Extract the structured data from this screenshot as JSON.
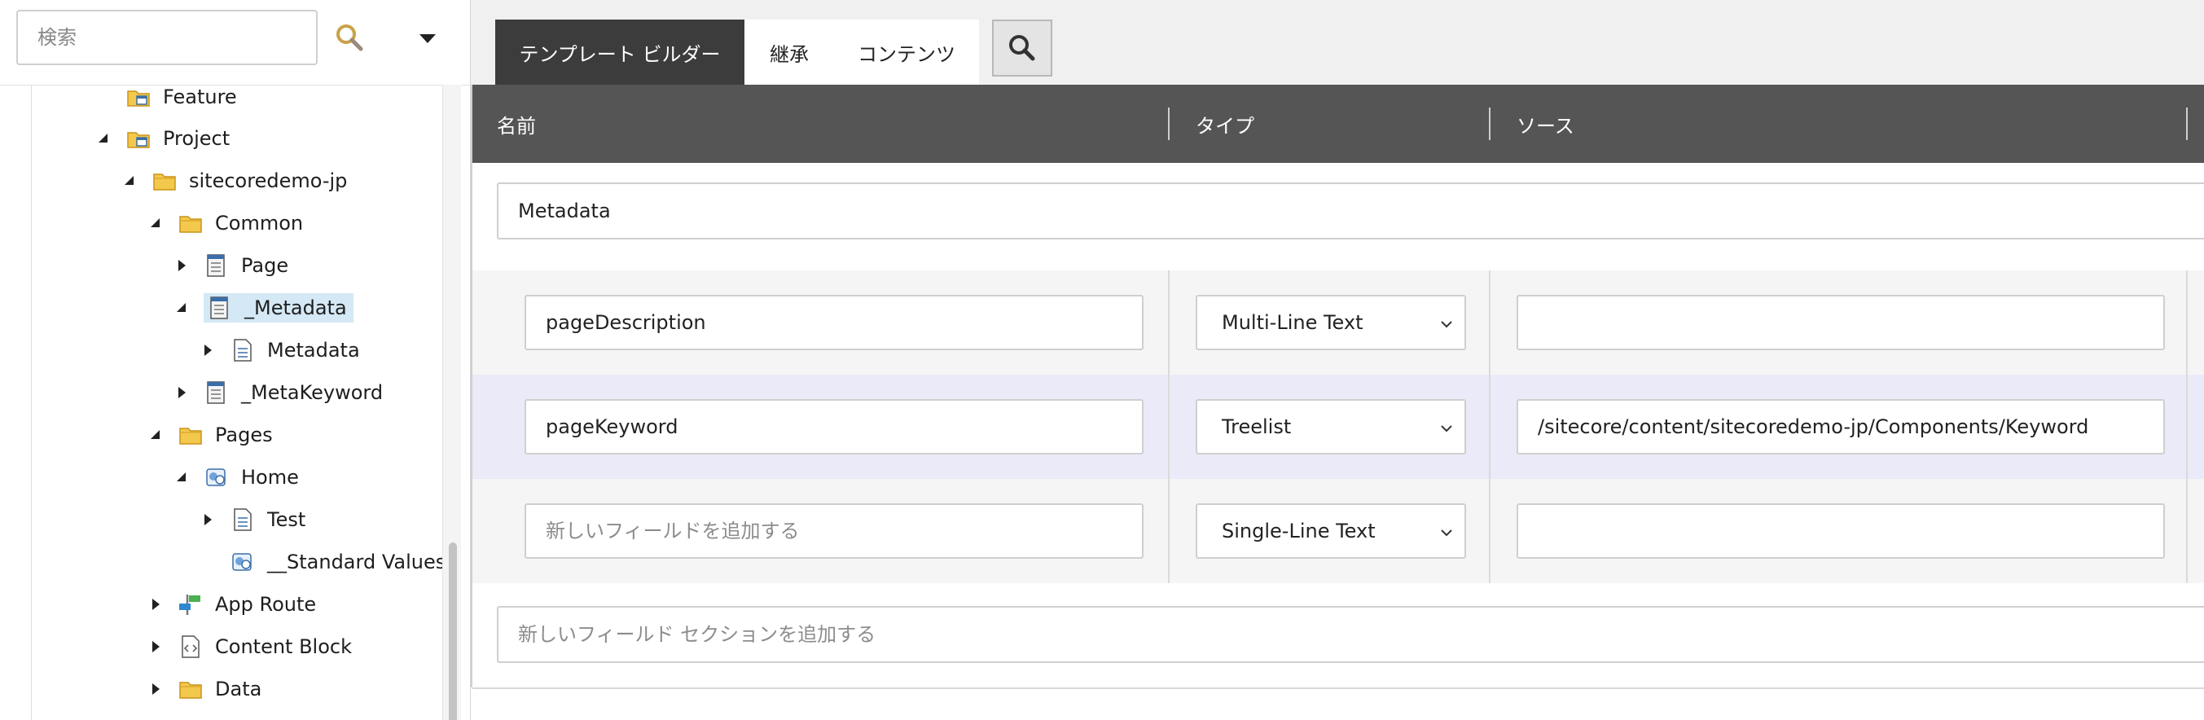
{
  "left": {
    "search_placeholder": "検索",
    "tree": [
      {
        "label": "Feature",
        "icon": "template-folder-icon"
      },
      {
        "label": "Project",
        "icon": "template-folder-icon"
      },
      {
        "label": "sitecoredemo-jp",
        "icon": "folder-icon"
      },
      {
        "label": "Common",
        "icon": "folder-icon"
      },
      {
        "label": "Page",
        "icon": "template-icon"
      },
      {
        "label": "_Metadata",
        "icon": "template-icon"
      },
      {
        "label": "Metadata",
        "icon": "section-icon"
      },
      {
        "label": "_MetaKeyword",
        "icon": "template-icon"
      },
      {
        "label": "Pages",
        "icon": "folder-icon"
      },
      {
        "label": "Home",
        "icon": "page-template-icon"
      },
      {
        "label": "Test",
        "icon": "section-icon"
      },
      {
        "label": "__Standard Values",
        "icon": "page-template-icon"
      },
      {
        "label": "App Route",
        "icon": "route-icon"
      },
      {
        "label": "Content Block",
        "icon": "content-block-icon"
      },
      {
        "label": "Data",
        "icon": "folder-icon"
      }
    ]
  },
  "tabs": {
    "builder": "テンプレート ビルダー",
    "inherit": "継承",
    "content": "コンテンツ"
  },
  "grid": {
    "headers": {
      "name": "名前",
      "type": "タイプ",
      "source": "ソース"
    },
    "section_name": "Metadata",
    "fields": [
      {
        "name": "pageDescription",
        "type": "Multi-Line Text",
        "source": ""
      },
      {
        "name": "pageKeyword",
        "type": "Treelist",
        "source": "/sitecore/content/sitecoredemo-jp/Components/Keyword"
      }
    ],
    "new_field": {
      "placeholder": "新しいフィールドを追加する",
      "type": "Single-Line Text",
      "source": ""
    },
    "new_section_placeholder": "新しいフィールド セクションを追加する"
  },
  "colors": {
    "tab_active": "#3c3c3c",
    "header_bg": "#555555",
    "selected_bg": "#d4e8f5",
    "highlight_row": "#eaeaf8"
  }
}
